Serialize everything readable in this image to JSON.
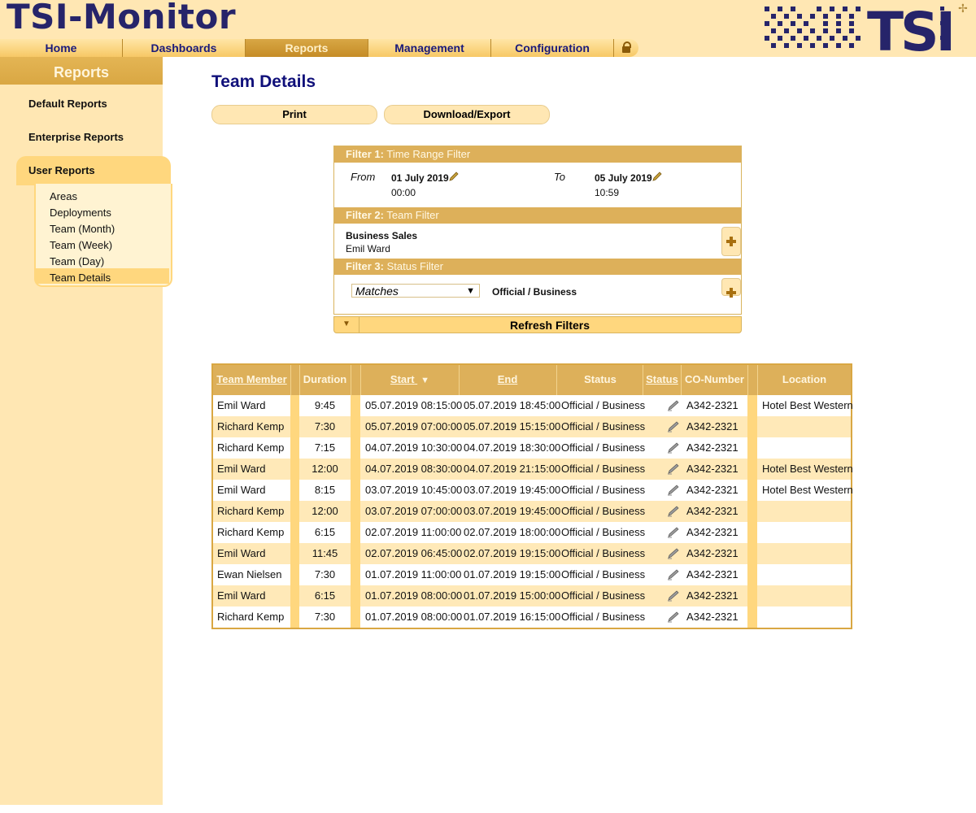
{
  "app": {
    "title": "TSI-Monitor"
  },
  "nav": {
    "items": [
      {
        "label": "Home",
        "active": false
      },
      {
        "label": "Dashboards",
        "active": false
      },
      {
        "label": "Reports",
        "active": true
      },
      {
        "label": "Management",
        "active": false
      },
      {
        "label": "Configuration",
        "active": false
      }
    ],
    "lock_icon": "lock-icon"
  },
  "logo": {
    "text": "TSI"
  },
  "sidebar": {
    "heading": "Reports",
    "items": [
      "Default Reports",
      "Enterprise Reports",
      "User Reports"
    ],
    "sub_items": [
      "Areas",
      "Deployments",
      "Team (Month)",
      "Team (Week)",
      "Team (Day)",
      "Team Details"
    ],
    "active_sub": "Team Details"
  },
  "main": {
    "title": "Team Details",
    "print_label": "Print",
    "export_label": "Download/Export"
  },
  "filters": {
    "f1": {
      "prefix": "Filter 1:",
      "name": "Time Range Filter",
      "from_label": "From",
      "from_date": "01 July 2019",
      "from_time": "00:00",
      "to_label": "To",
      "to_date": "05 July 2019",
      "to_time": "10:59"
    },
    "f2": {
      "prefix": "Filter 2:",
      "name": "Team Filter",
      "team": "Business Sales",
      "member": "Emil Ward"
    },
    "f3": {
      "prefix": "Filter 3:",
      "name": "Status Filter",
      "match": "Matches",
      "value": "Official / Business"
    },
    "refresh_label": "Refresh Filters"
  },
  "table": {
    "headers": {
      "member": "Team Member",
      "duration": "Duration",
      "start": "Start",
      "end": "End",
      "status": "Status",
      "status2": "Status",
      "co": "CO-Number",
      "location": "Location"
    },
    "sort_indicator": "▼",
    "rows": [
      {
        "member": "Emil Ward",
        "duration": "9:45",
        "start": "05.07.2019 08:15:00",
        "end": "05.07.2019 18:45:00",
        "status": "Official / Business",
        "co": "A342-2321",
        "location": "Hotel Best Western"
      },
      {
        "member": "Richard Kemp",
        "duration": "7:30",
        "start": "05.07.2019 07:00:00",
        "end": "05.07.2019 15:15:00",
        "status": "Official / Business",
        "co": "A342-2321",
        "location": ""
      },
      {
        "member": "Richard Kemp",
        "duration": "7:15",
        "start": "04.07.2019 10:30:00",
        "end": "04.07.2019 18:30:00",
        "status": "Official / Business",
        "co": "A342-2321",
        "location": ""
      },
      {
        "member": "Emil Ward",
        "duration": "12:00",
        "start": "04.07.2019 08:30:00",
        "end": "04.07.2019 21:15:00",
        "status": "Official / Business",
        "co": "A342-2321",
        "location": "Hotel Best Western"
      },
      {
        "member": "Emil Ward",
        "duration": "8:15",
        "start": "03.07.2019 10:45:00",
        "end": "03.07.2019 19:45:00",
        "status": "Official / Business",
        "co": "A342-2321",
        "location": "Hotel Best Western"
      },
      {
        "member": "Richard Kemp",
        "duration": "12:00",
        "start": "03.07.2019 07:00:00",
        "end": "03.07.2019 19:45:00",
        "status": "Official / Business",
        "co": "A342-2321",
        "location": ""
      },
      {
        "member": "Richard Kemp",
        "duration": "6:15",
        "start": "02.07.2019 11:00:00",
        "end": "02.07.2019 18:00:00",
        "status": "Official / Business",
        "co": "A342-2321",
        "location": ""
      },
      {
        "member": "Emil Ward",
        "duration": "11:45",
        "start": "02.07.2019 06:45:00",
        "end": "02.07.2019 19:15:00",
        "status": "Official / Business",
        "co": "A342-2321",
        "location": ""
      },
      {
        "member": "Ewan Nielsen",
        "duration": "7:30",
        "start": "01.07.2019 11:00:00",
        "end": "01.07.2019 19:15:00",
        "status": "Official / Business",
        "co": "A342-2321",
        "location": ""
      },
      {
        "member": "Emil Ward",
        "duration": "6:15",
        "start": "01.07.2019 08:00:00",
        "end": "01.07.2019 15:00:00",
        "status": "Official / Business",
        "co": "A342-2321",
        "location": ""
      },
      {
        "member": "Richard Kemp",
        "duration": "7:30",
        "start": "01.07.2019 08:00:00",
        "end": "01.07.2019 16:15:00",
        "status": "Official / Business",
        "co": "A342-2321",
        "location": ""
      }
    ]
  },
  "colors": {
    "brand_navy": "#26246a",
    "panel": "#ffe7b3",
    "accent": "#ddb05a",
    "highlight": "#ffd77e"
  }
}
